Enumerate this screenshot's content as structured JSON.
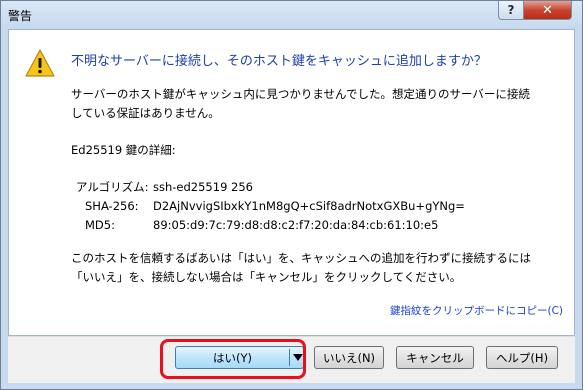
{
  "window": {
    "title": "警告",
    "help_button": "?",
    "close_button": "✕"
  },
  "dialog": {
    "icon": "warning-icon",
    "headline": "不明なサーバーに接続し、そのホスト鍵をキャッシュに追加しますか？",
    "message_line1": "サーバーのホスト鍵がキャッシュ内に見つかりませんでした。想定通りのサーバーに接続",
    "message_line2": "している保証はありません。",
    "details_heading": "Ed25519 鍵の詳細:",
    "details": [
      {
        "label": "アルゴリズム:",
        "value": "ssh-ed25519 256"
      },
      {
        "label": "SHA-256:",
        "value": "D2AjNvvigSIbxkY1nM8gQ+cSif8adrNotxGXBu+gYNg="
      },
      {
        "label": "MD5:",
        "value": "89:05:d9:7c:79:d8:d8:c2:f7:20:da:84:cb:61:10:e5"
      }
    ],
    "instruction_line1": "このホストを信頼するばあいは「はい」を、キャッシュへの追加を行わずに接続するには",
    "instruction_line2": "「いいえ」を、接続しない場合は「キャンセル」をクリックしてください。",
    "copy_link": "鍵指紋をクリップボードにコピー(C)"
  },
  "buttons": {
    "yes": "はい(Y)",
    "no": "いいえ(N)",
    "cancel": "キャンセル",
    "help": "ヘルプ(H)"
  },
  "colors": {
    "headline": "#1c3fb0",
    "link": "#1a3ecf",
    "highlight_border": "#e8101c"
  }
}
